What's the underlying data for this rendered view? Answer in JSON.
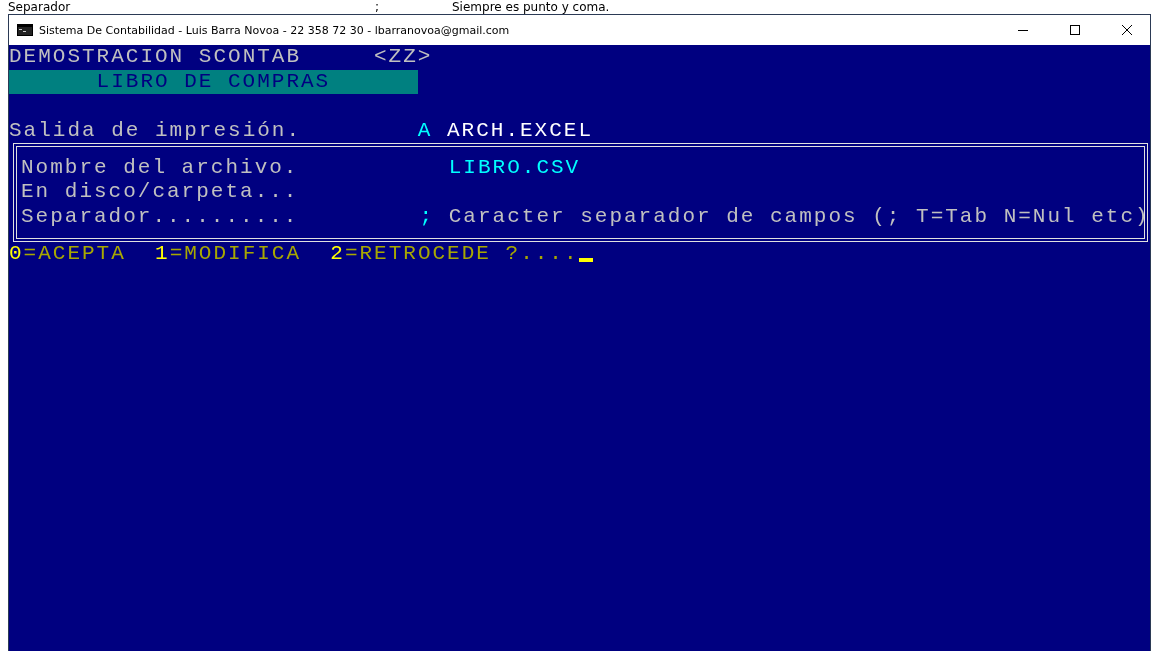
{
  "background_text": {
    "label": "Separador",
    "key": ";",
    "note": "Siempre es punto y coma."
  },
  "window": {
    "title": "Sistema De Contabilidad - Luis Barra Novoa - 22 358 72 30 - lbarranovoa@gmail.com"
  },
  "header": {
    "company": "DEMOSTRACION SCONTAB",
    "code": "<ZZ>",
    "report": "LIBRO DE COMPRAS"
  },
  "output": {
    "label": "Salida de impresión.",
    "key": "A",
    "value": "ARCH.EXCEL"
  },
  "file_panel": {
    "fields": [
      {
        "label": "Nombre del archivo.",
        "value": "LIBRO.CSV"
      },
      {
        "label": "En disco/carpeta..."
      },
      {
        "label": "Separador..........",
        "key": ";",
        "note": "Caracter separador de campos (; T=Tab N=Nul etc)"
      }
    ]
  },
  "options": [
    {
      "key": "0",
      "label": "=ACEPTA"
    },
    {
      "key": "1",
      "label": "=MODIFICA"
    },
    {
      "key": "2",
      "label": "=RETROCEDE ?...."
    }
  ]
}
